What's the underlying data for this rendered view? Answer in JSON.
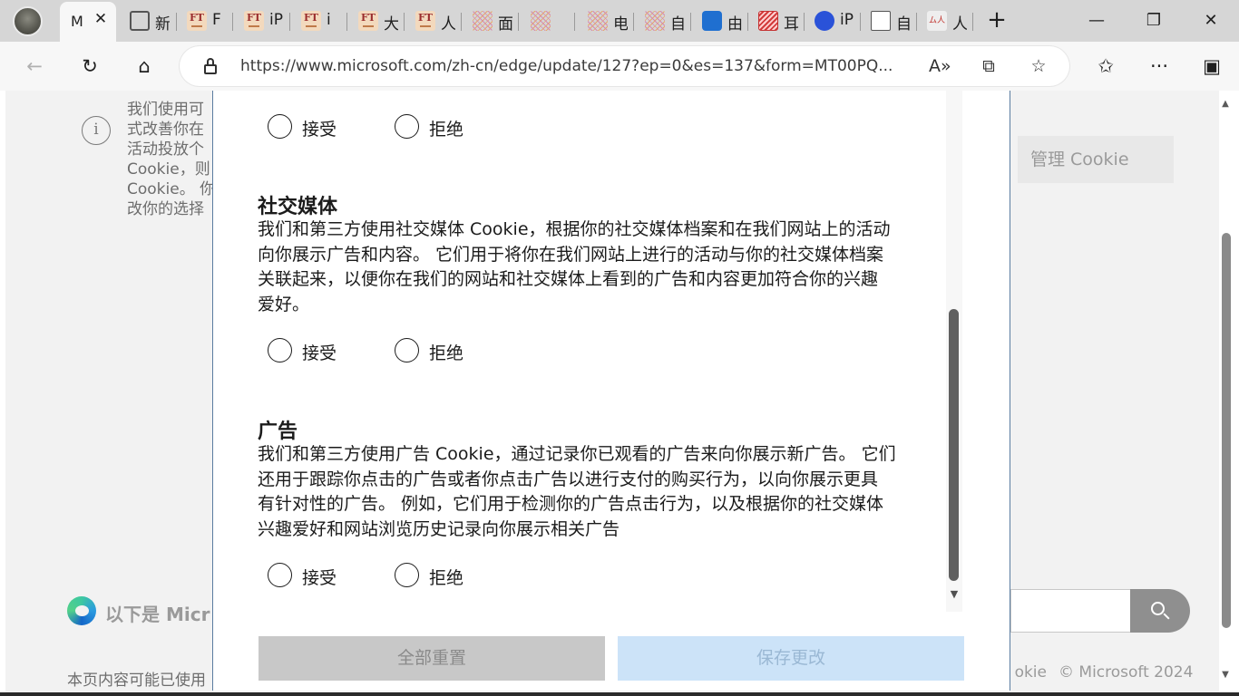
{
  "tabs": {
    "active": {
      "title": "M",
      "close": "✕"
    },
    "items": [
      {
        "label": "新",
        "icon": "calendar-icon"
      },
      {
        "label": "F",
        "icon": "ft-icon"
      },
      {
        "label": "iP",
        "icon": "ft-icon"
      },
      {
        "label": "i",
        "icon": "ft-icon"
      },
      {
        "label": "大",
        "icon": "ft-icon"
      },
      {
        "label": "人",
        "icon": "ft-icon"
      },
      {
        "label": "面",
        "icon": "lattice-icon"
      },
      {
        "label": "",
        "icon": "lattice-icon"
      },
      {
        "label": "电",
        "icon": "lattice-icon"
      },
      {
        "label": "自",
        "icon": "lattice-icon"
      },
      {
        "label": "由",
        "icon": "outlook-icon"
      },
      {
        "label": "耳",
        "icon": "stripe-icon"
      },
      {
        "label": "iP",
        "icon": "paw-icon"
      },
      {
        "label": "自",
        "icon": "doc-icon"
      },
      {
        "label": "人",
        "icon": "signature-icon"
      }
    ],
    "new_tab": "+"
  },
  "window": {
    "minimize": "—",
    "restore": "❐",
    "close": "✕"
  },
  "toolbar": {
    "back": "←",
    "refresh": "↻",
    "home": "⌂",
    "url": "https://www.microsoft.com/zh-cn/edge/update/127?ep=0&es=137&form=MT00PQ...",
    "read_aloud": "A»",
    "immersive": "⧉",
    "favorite": "☆",
    "favorites": "✩",
    "more": "···",
    "sidebar": "▣"
  },
  "page": {
    "banner_lines": [
      "我们使用可",
      "式改善你在",
      "活动投放个",
      "Cookie，则",
      "Cookie。 你",
      "改你的选择"
    ],
    "info_icon": "i",
    "manage_cookie": "管理 Cookie",
    "promo": "以下是 Micr",
    "footer_left": "本页内容可能已使用",
    "footer_link": "okie",
    "footer_copy": "© Microsoft 2024",
    "scroll_up": "▲",
    "scroll_down": "▼"
  },
  "dialog": {
    "top_row": {
      "accept": "接受",
      "reject": "拒绝"
    },
    "social": {
      "title": "社交媒体",
      "lines": [
        "我们和第三方使用社交媒体 Cookie，根据你的社交媒体档案和在我们网站上的活动",
        "向你展示广告和内容。 它们用于将你在我们网站上进行的活动与你的社交媒体档案",
        "关联起来，以便你在我们的网站和社交媒体上看到的广告和内容更加符合你的兴趣",
        "爱好。"
      ],
      "accept": "接受",
      "reject": "拒绝"
    },
    "ads": {
      "title": "广告",
      "lines": [
        "我们和第三方使用广告 Cookie，通过记录你已观看的广告来向你展示新广告。 它们",
        "还用于跟踪你点击的广告或者你点击广告以进行支付的购买行为，以向你展示更具",
        "有针对性的广告。 例如，它们用于检测你的广告点击行为，以及根据你的社交媒体",
        "兴趣爱好和网站浏览历史记录向你展示相关广告"
      ],
      "accept": "接受",
      "reject": "拒绝"
    },
    "scroll_down": "▼",
    "reset_all": "全部重置",
    "save_changes": "保存更改"
  }
}
